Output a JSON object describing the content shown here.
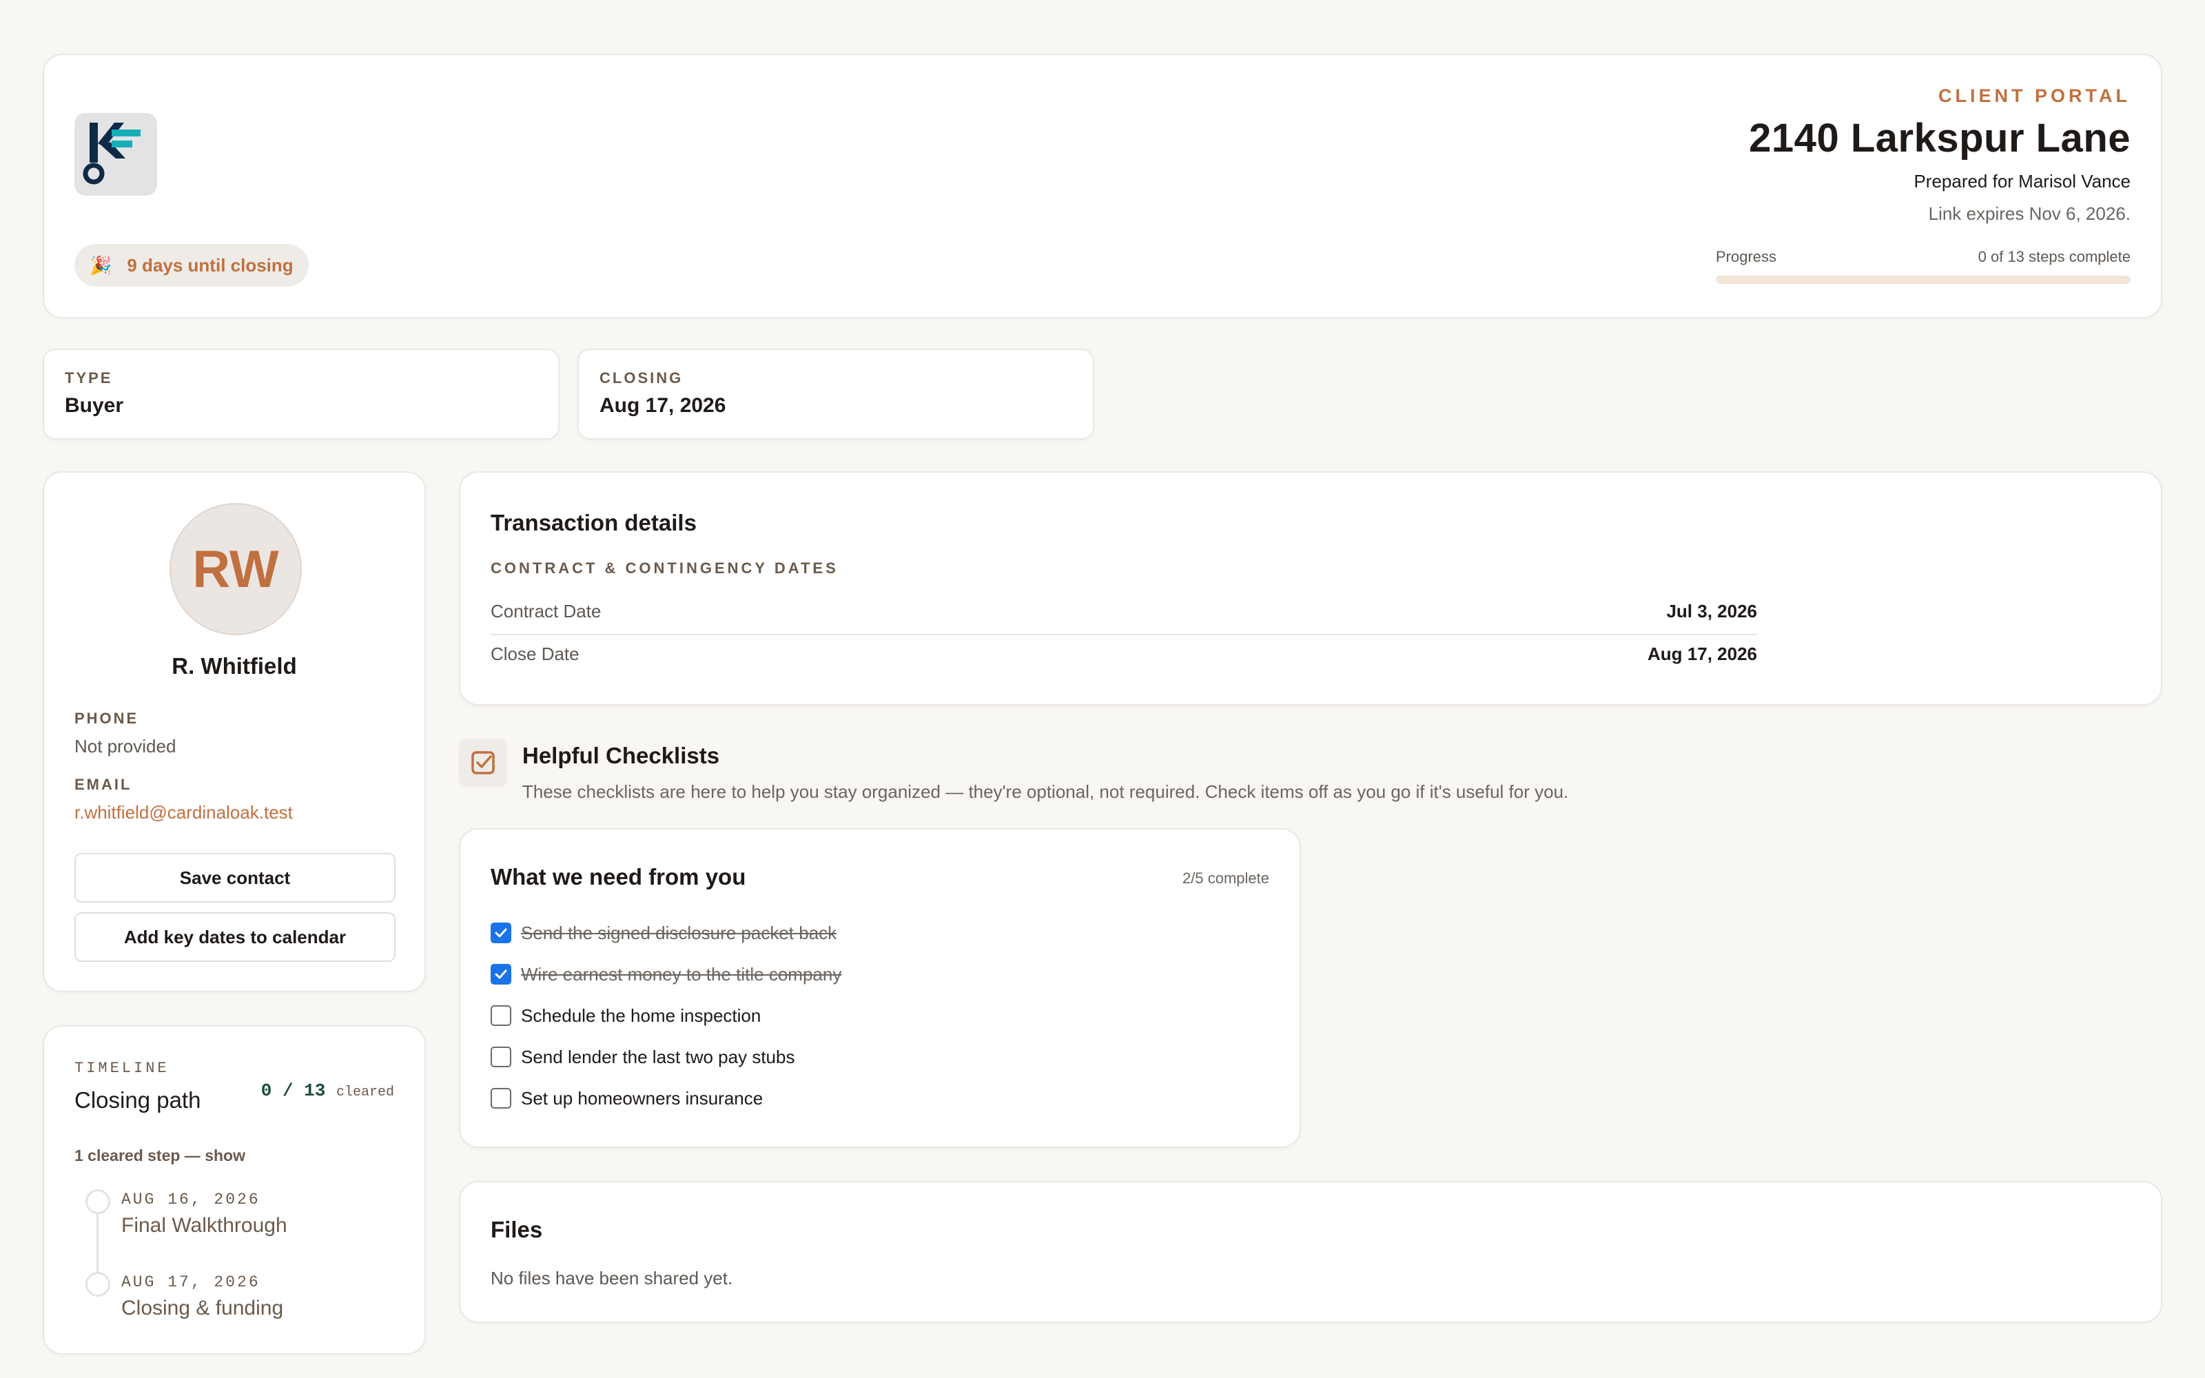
{
  "header": {
    "eyebrow": "CLIENT PORTAL",
    "address": "2140 Larkspur Lane",
    "prepared_for": "Prepared for Marisol Vance",
    "expires": "Link expires Nov 6, 2026.",
    "countdown_emoji": "🎉",
    "countdown": "9 days until closing",
    "progress_label": "Progress",
    "progress_status": "0 of 13 steps complete",
    "progress_fraction": 0,
    "logo_icon": "key-logo-icon"
  },
  "stats": {
    "type_label": "TYPE",
    "type_value": "Buyer",
    "closing_label": "CLOSING",
    "closing_value": "Aug 17, 2026"
  },
  "contact": {
    "initials": "RW",
    "name": "R. Whitfield",
    "phone_label": "PHONE",
    "phone_value": "Not provided",
    "email_label": "EMAIL",
    "email_value": "r.whitfield@cardinaloak.test",
    "save_button": "Save contact",
    "calendar_button": "Add key dates to calendar"
  },
  "timeline": {
    "eyebrow": "TIMELINE",
    "title": "Closing path",
    "count_main": "0 / 13",
    "count_suffix": "cleared",
    "toggle": "1 cleared step — show",
    "steps": [
      {
        "date": "AUG 16, 2026",
        "label": "Final Walkthrough"
      },
      {
        "date": "AUG 17, 2026",
        "label": "Closing & funding"
      }
    ]
  },
  "details": {
    "title": "Transaction details",
    "section": "CONTRACT & CONTINGENCY DATES",
    "rows": [
      {
        "key": "Contract Date",
        "value": "Jul 3, 2026"
      },
      {
        "key": "Close Date",
        "value": "Aug 17, 2026"
      }
    ]
  },
  "checklists": {
    "title": "Helpful Checklists",
    "description": "These checklists are here to help you stay organized — they're optional, not required. Check items off as you go if it's useful for you.",
    "icon": "checklist-icon"
  },
  "needs": {
    "title": "What we need from you",
    "count": "2/5 complete",
    "items": [
      {
        "label": "Send the signed disclosure packet back",
        "checked": true
      },
      {
        "label": "Wire earnest money to the title company",
        "checked": true
      },
      {
        "label": "Schedule the home inspection",
        "checked": false
      },
      {
        "label": "Send lender the last two pay stubs",
        "checked": false
      },
      {
        "label": "Set up homeowners insurance",
        "checked": false
      }
    ]
  },
  "files": {
    "title": "Files",
    "empty": "No files have been shared yet."
  },
  "colors": {
    "accent": "#c1703f",
    "background": "#f8f7f4",
    "checkbox_checked": "#1a73e8",
    "timeline_count": "#1b4d3e"
  }
}
